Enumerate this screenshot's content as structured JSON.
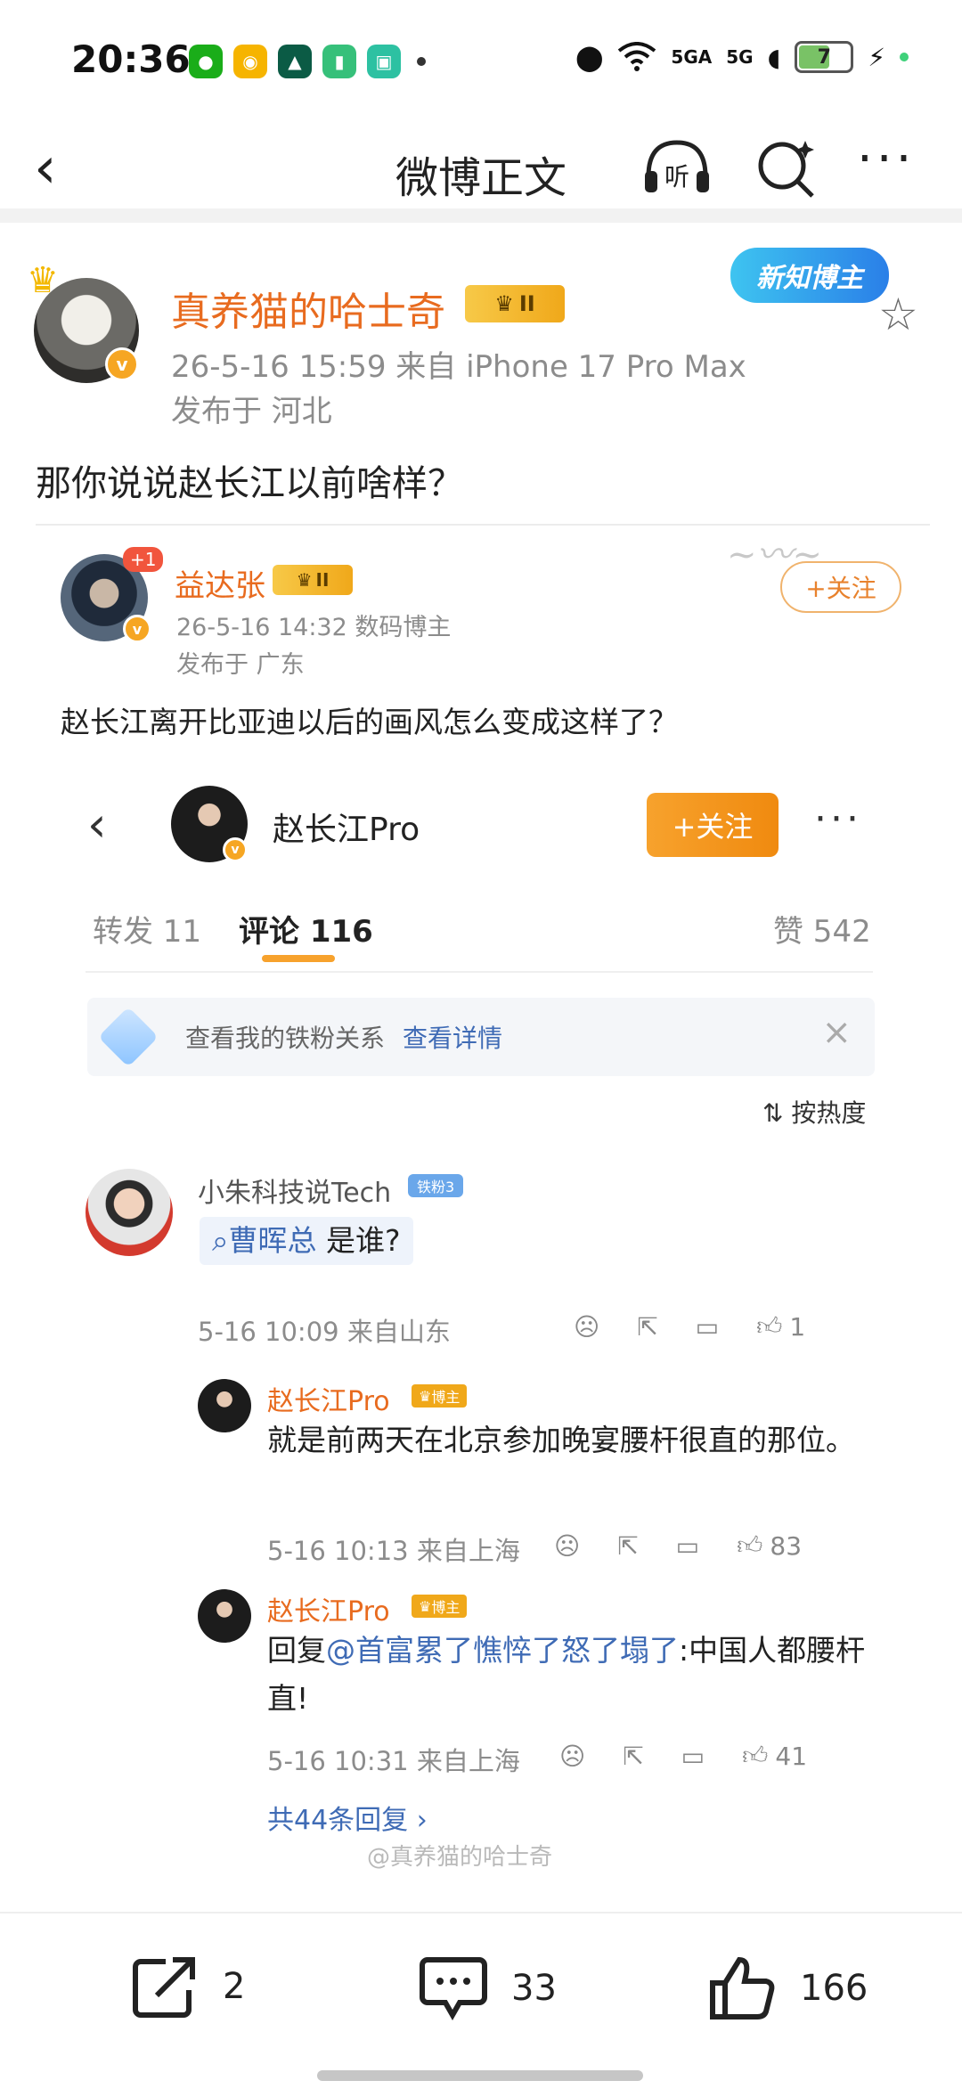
{
  "status": {
    "time": "20:36",
    "battery": "7",
    "signal1": "5GA",
    "signal2": "5G"
  },
  "nav": {
    "title": "微博正文",
    "listen_label": "听"
  },
  "post": {
    "author": "真养猫的哈士奇",
    "level": "II",
    "meta": "26-5-16 15:59  来自 iPhone 17 Pro Max",
    "location": "发布于 河北",
    "badge": "新知博主",
    "text": "那你说说赵长江以前啥样？"
  },
  "repost": {
    "plus": "+1",
    "author": "益达张",
    "level": "II",
    "meta": "26-5-16 14:32  数码博主",
    "location": "发布于 广东",
    "follow": "+关注",
    "text": "赵长江离开比亚迪以后的画风怎么变成这样了？"
  },
  "embedded": {
    "name": "赵长江Pro",
    "follow": "+关注",
    "tabs": {
      "repost": "转发 11",
      "comment": "评论 116",
      "like": "赞 542"
    },
    "fan_bar": {
      "text": "查看我的铁粉关系",
      "link": "查看详情"
    },
    "sort": "按热度",
    "comments": [
      {
        "name": "小朱科技说Tech",
        "tag": "铁粉3",
        "query": "曹晖总",
        "text": "是谁?",
        "meta": "5-16 10:09 来自山东",
        "likes": "1"
      },
      {
        "name": "赵长江Pro",
        "tag": "博主",
        "text": "就是前两天在北京参加晚宴腰杆很直的那位。",
        "meta": "5-16 10:13 来自上海",
        "likes": "83"
      },
      {
        "name": "赵长江Pro",
        "tag": "博主",
        "text_prefix": "回复",
        "mention": "@首富累了憔悴了怒了塌了",
        "text": ":中国人都腰杆直!",
        "meta": "5-16 10:31 来自上海",
        "likes": "41"
      }
    ],
    "replies": "共44条回复 ›",
    "watermark": "@真养猫的哈士奇"
  },
  "bottom": {
    "reposts": "2",
    "comments": "33",
    "likes": "166"
  }
}
